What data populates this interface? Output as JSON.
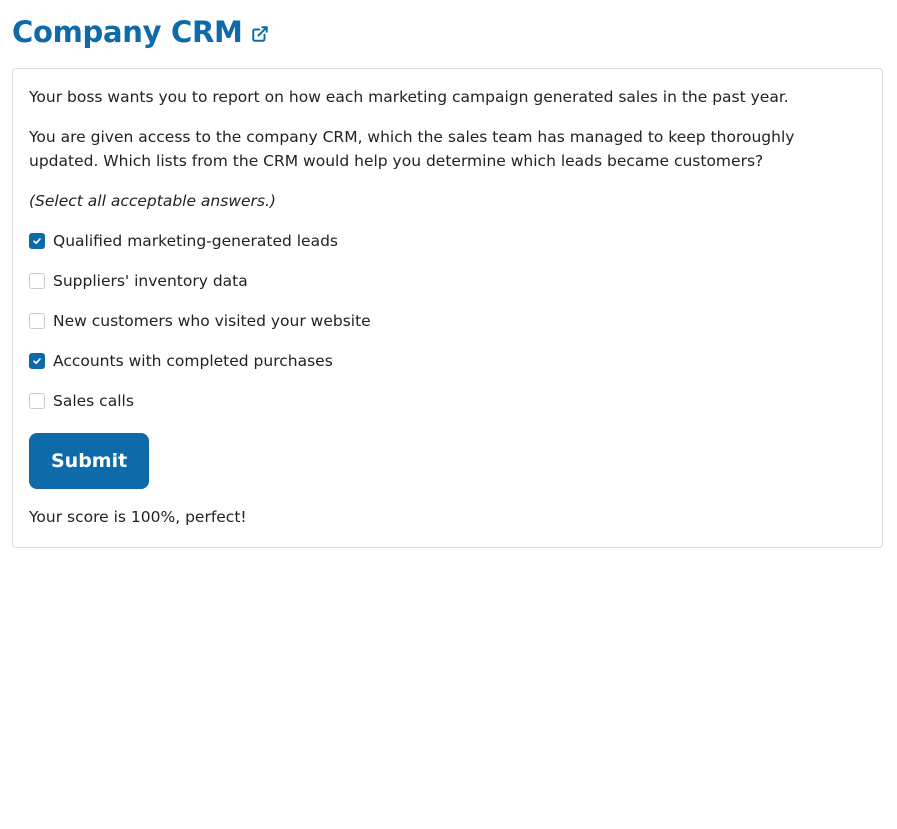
{
  "header": {
    "title": "Company CRM",
    "link_icon": "external-link-icon"
  },
  "question": {
    "paragraph_1": "Your boss wants you to report on how each marketing campaign generated sales in the past year.",
    "paragraph_2": "You are given access to the company CRM, which the sales team has managed to keep thoroughly updated. Which lists from the CRM would help you determine which leads became customers?",
    "instruction": "(Select all acceptable answers.)",
    "options": [
      {
        "label": "Qualified marketing-generated leads",
        "checked": true
      },
      {
        "label": "Suppliers' inventory data",
        "checked": false
      },
      {
        "label": "New customers who visited your website",
        "checked": false
      },
      {
        "label": "Accounts with completed purchases",
        "checked": true
      },
      {
        "label": "Sales calls",
        "checked": false
      }
    ],
    "submit_label": "Submit",
    "score_text": "Your score is 100%, perfect!"
  },
  "colors": {
    "accent": "#0e6aa8",
    "border": "#d9dbde",
    "text": "#222222"
  }
}
